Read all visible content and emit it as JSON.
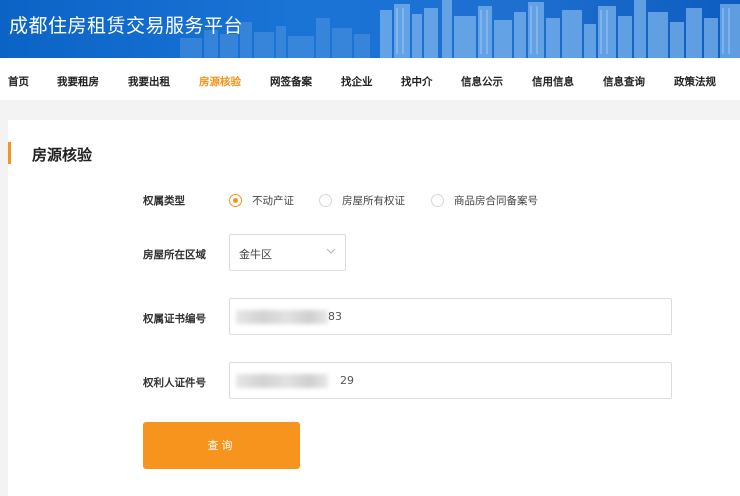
{
  "header": {
    "title": "成都住房租赁交易服务平台"
  },
  "nav": {
    "items": [
      {
        "label": "首页",
        "active": false
      },
      {
        "label": "我要租房",
        "active": false
      },
      {
        "label": "我要出租",
        "active": false
      },
      {
        "label": "房源核验",
        "active": true
      },
      {
        "label": "网签备案",
        "active": false
      },
      {
        "label": "找企业",
        "active": false
      },
      {
        "label": "找中介",
        "active": false
      },
      {
        "label": "信息公示",
        "active": false
      },
      {
        "label": "信用信息",
        "active": false
      },
      {
        "label": "信息查询",
        "active": false
      },
      {
        "label": "政策法规",
        "active": false
      }
    ]
  },
  "main": {
    "section_title": "房源核验",
    "ownership_type": {
      "label": "权属类型",
      "options": [
        {
          "label": "不动产证",
          "checked": true
        },
        {
          "label": "房屋所有权证",
          "checked": false
        },
        {
          "label": "商品房合同备案号",
          "checked": false
        }
      ]
    },
    "district": {
      "label": "房屋所在区域",
      "value": "金牛区"
    },
    "cert_number": {
      "label": "权属证书编号",
      "visible_suffix": "83"
    },
    "owner_id": {
      "label": "权利人证件号",
      "visible_suffix": "29"
    },
    "query_button": "查询"
  },
  "colors": {
    "accent": "#f7941d",
    "header_blue": "#1a74d6",
    "text": "#222222",
    "background": "#f3f3f3"
  }
}
